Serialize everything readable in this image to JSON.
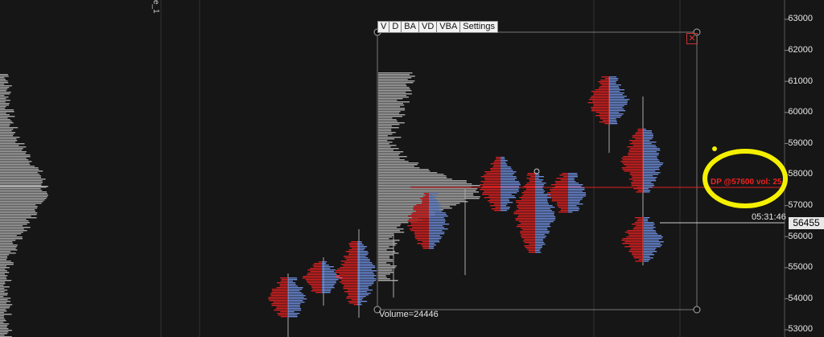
{
  "toolbar": {
    "items": [
      "V",
      "D",
      "BA",
      "VD",
      "VBA",
      "Settings"
    ]
  },
  "price_axis": {
    "labels": [
      "63000",
      "62000",
      "61000",
      "60000",
      "59000",
      "58000",
      "57000",
      "56000",
      "55000",
      "54000",
      "53000"
    ]
  },
  "current_price": "56455",
  "timer": "05:31:46",
  "volume_label": "Volume=24446",
  "dp_label": "DP @57600 vol: 25",
  "vertical_label": "e_1",
  "colors": {
    "background": "#161616",
    "bid": "#e02020",
    "ask": "#6f8fe0",
    "profile": "#a8a8a8",
    "highlight": "#f5f000"
  }
}
